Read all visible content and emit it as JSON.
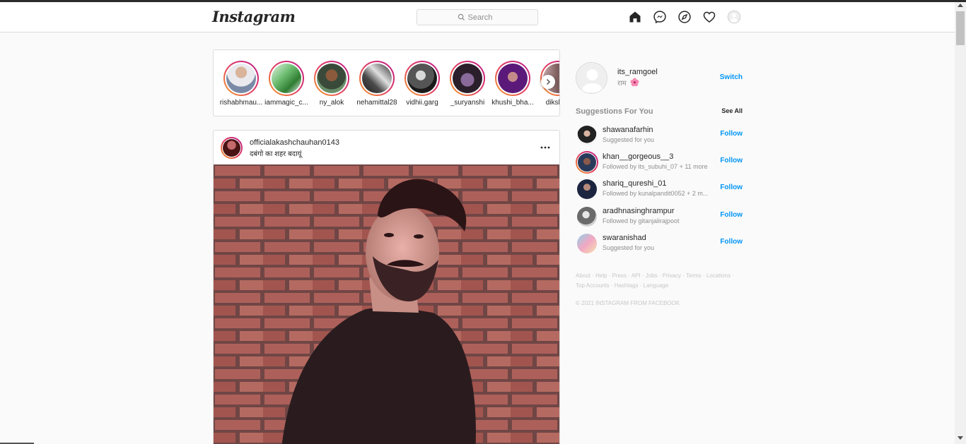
{
  "brand": {
    "logo_text": "Instagram"
  },
  "search": {
    "placeholder": "Search"
  },
  "nav": {
    "icons": [
      "home-icon",
      "messenger-icon",
      "explore-icon",
      "heart-icon",
      "profile-avatar-icon"
    ]
  },
  "stories": [
    {
      "name": "rishabhmau..."
    },
    {
      "name": "iammagic_c..."
    },
    {
      "name": "ny_alok"
    },
    {
      "name": "nehamittal28"
    },
    {
      "name": "vidhii.garg"
    },
    {
      "name": "_suryanshi"
    },
    {
      "name": "khushi_bha..."
    },
    {
      "name": "dikshaa"
    }
  ],
  "post": {
    "username": "officialakashchauhan0143",
    "location": "दबंगो का शहर बदायूं"
  },
  "profile": {
    "username": "its_ramgoel",
    "full_name": "राम",
    "switch_label": "Switch"
  },
  "suggestions": {
    "heading": "Suggestions For You",
    "see_all": "See All",
    "follow_label": "Follow",
    "items": [
      {
        "username": "shawanafarhin",
        "subtitle": "Suggested for you"
      },
      {
        "username": "khan__gorgeous__3",
        "subtitle": "Followed by its_subuhi_07 + 11 more"
      },
      {
        "username": "shariq_qureshi_01",
        "subtitle": "Followed by kunalpandit0052 + 2 m..."
      },
      {
        "username": "aradhnasinghrampur",
        "subtitle": "Followed by gitanjalirajpoot"
      },
      {
        "username": "swaranishad",
        "subtitle": "Suggested for you"
      }
    ]
  },
  "footer": {
    "links": [
      "About",
      "Help",
      "Press",
      "API",
      "Jobs",
      "Privacy",
      "Terms",
      "Locations",
      "Top Accounts",
      "Hashtags",
      "Language"
    ],
    "copyright": "© 2021 INSTAGRAM FROM FACEBOOK"
  },
  "colors": {
    "link_blue": "#0095f6",
    "border": "#dbdbdb",
    "background": "#fafafa",
    "muted_text": "#8e8e8e"
  }
}
